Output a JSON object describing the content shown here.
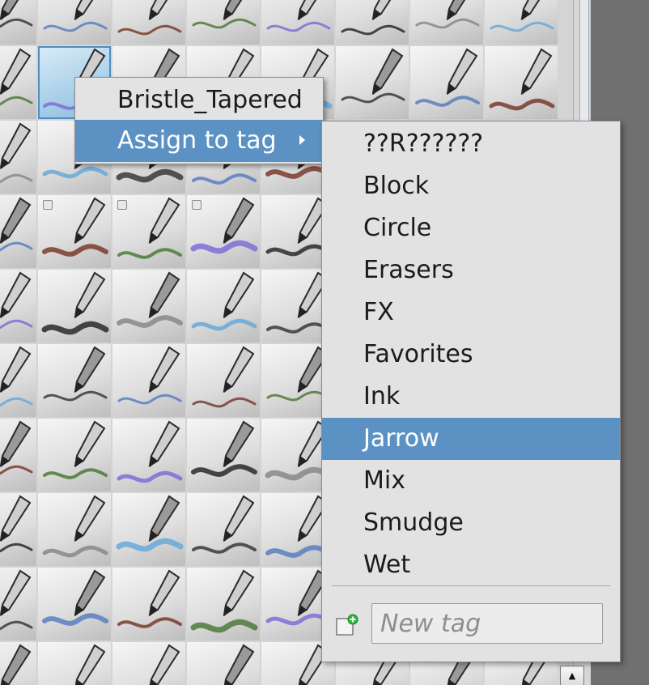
{
  "context_menu": {
    "preset_name": "Bristle_Tapered",
    "assign_label": "Assign to tag"
  },
  "submenu": {
    "tags": [
      "??R??????",
      "Block",
      "Circle",
      "Erasers",
      "FX",
      "Favorites",
      "Ink",
      "Jarrow",
      "Mix",
      "Smudge",
      "Wet"
    ],
    "highlighted_tag": "Jarrow",
    "new_tag_placeholder": "New tag",
    "new_tag_icon": "new-tag-plus-icon"
  },
  "brush_grid": {
    "rows": 10,
    "columns": 8,
    "selected_tile": "row 2, column 2",
    "tile_icon": "brush-preset-icon"
  },
  "scrollbar": {
    "up_arrow_icon": "scroll-up-arrow-icon"
  },
  "colors": {
    "highlight": "#5b92c3",
    "menu_background": "#e2e2e2",
    "panel_background": "#d4d4d4"
  }
}
